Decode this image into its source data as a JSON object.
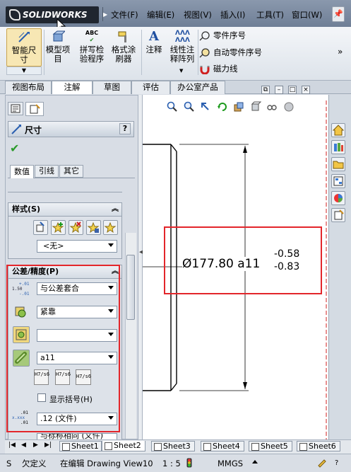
{
  "app": {
    "logo_text": "SOLIDWORKS"
  },
  "menu": [
    {
      "label": "文件(F)"
    },
    {
      "label": "编辑(E)"
    },
    {
      "label": "视图(V)"
    },
    {
      "label": "插入(I)"
    },
    {
      "label": "工具(T)"
    },
    {
      "label": "窗口(W)"
    }
  ],
  "commands": {
    "smart_dim": "智能尺寸",
    "model_items": "模型项目",
    "spell_check": "拼写检验程序",
    "format_painter": "格式涂刷器",
    "note": "注释",
    "linear_note": "线性注释阵列",
    "balloon": "零件序号",
    "auto_balloon": "自动零件序号",
    "magnetic_line": "磁力线",
    "abc_label": "ABC",
    "more": "»"
  },
  "tabs": [
    {
      "label": "视图布局"
    },
    {
      "label": "注解"
    },
    {
      "label": "草图"
    },
    {
      "label": "评估"
    },
    {
      "label": "办公室产品"
    }
  ],
  "panel": {
    "title": "尺寸",
    "help": "?",
    "subtabs": [
      "数值",
      "引线",
      "其它"
    ],
    "style_section": "样式(S)",
    "style_value": "<无>",
    "tol_section": "公差/精度(P)",
    "tol_type": "与公差套合",
    "fit_type": "紧靠",
    "hole_fit": "",
    "shaft_fit": "a11",
    "fit_btns": [
      "H7/s6",
      "H7/s6",
      "H7/s6"
    ],
    "show_parens": "显示括号(H)",
    "precision": ".12 (文件)",
    "next_combo": "与标称相同 (文件)",
    "icon_labels": {
      "tol_top": "+.01",
      "tol_mid": "1.50",
      "tol_bot": "-.01",
      "prec_top": ".01",
      "prec_mid": "x.xxx",
      "prec_bot": ".01"
    }
  },
  "drawing": {
    "dim_main": "Ø177.80 a11",
    "dev_upper": "-0.58",
    "dev_lower": "-0.83",
    "highlight_color": "#e3262b"
  },
  "sheets": [
    "Sheet1",
    "Sheet2",
    "Sheet3",
    "Sheet4",
    "Sheet5",
    "Sheet6"
  ],
  "status": {
    "prefix": "S",
    "state": "欠定义",
    "editing": "在编辑 Drawing View10",
    "scale": "1 : 5",
    "units": "MMGS"
  }
}
